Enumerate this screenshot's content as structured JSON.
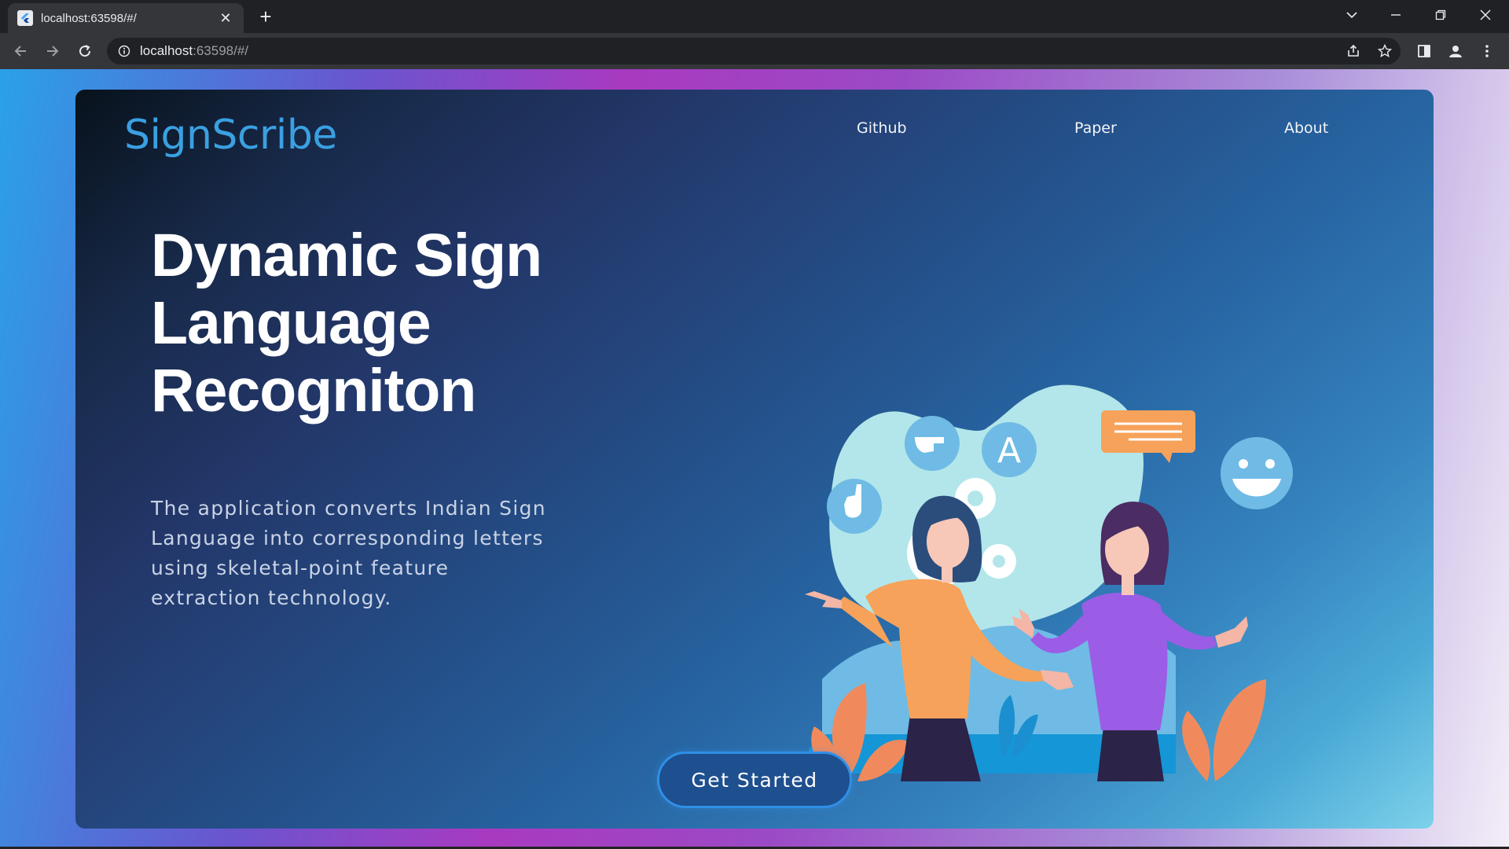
{
  "browser": {
    "tab_title": "localhost:63598/#/",
    "url_host": "localhost",
    "url_rest": ":63598/#/"
  },
  "site": {
    "logo": "SignScribe",
    "nav": [
      "Github",
      "Paper",
      "About"
    ]
  },
  "hero": {
    "headline": [
      "Dynamic Sign",
      "Language",
      "Recogniton"
    ],
    "description": "The application converts Indian Sign Language into corresponding letters using skeletal-point feature extraction technology.",
    "illustration_letter": "A",
    "cta_label": "Get Started"
  },
  "colors": {
    "logo": "#3aa0e2",
    "cta_border": "#2f8fe6",
    "cta_fill": "#1e4f8e"
  }
}
